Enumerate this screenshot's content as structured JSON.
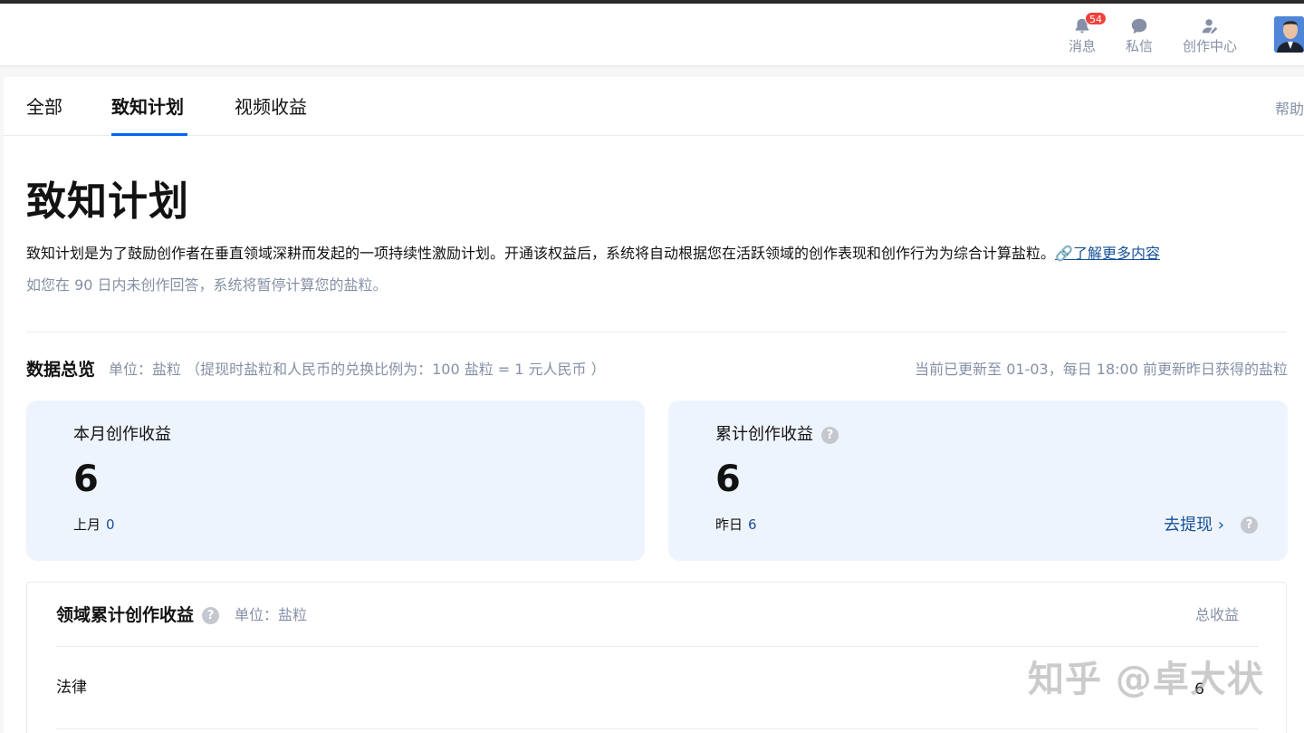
{
  "header": {
    "messages_label": "消息",
    "messages_badge": "54",
    "dm_label": "私信",
    "creator_label": "创作中心"
  },
  "tabs": [
    {
      "label": "全部"
    },
    {
      "label": "致知计划"
    },
    {
      "label": "视频收益"
    }
  ],
  "help_label": "帮助",
  "page": {
    "title": "致知计划",
    "description": "致知计划是为了鼓励创作者在垂直领域深耕而发起的一项持续性激励计划。开通该权益后，系统将自动根据您在活跃领域的创作表现和创作行为为综合计算盐粒。",
    "learn_more": "🔗了解更多内容",
    "note": "如您在 90 日内未创作回答，系统将暂停计算您的盐粒。"
  },
  "overview": {
    "title": "数据总览",
    "unit": "单位：盐粒  （提现时盐粒和人民币的兑换比例为：100 盐粒 = 1 元人民币 ）",
    "update_note": "当前已更新至 01-03，每日 18:00 前更新昨日获得的盐粒"
  },
  "cards": {
    "month": {
      "title": "本月创作收益",
      "value": "6",
      "sub_label": "上月",
      "sub_value": "0"
    },
    "total": {
      "title": "累计创作收益",
      "value": "6",
      "sub_label": "昨日",
      "sub_value": "6",
      "withdraw": "去提现 ›"
    }
  },
  "domain_table": {
    "title": "领域累计创作收益",
    "unit": "单位：盐粒",
    "column": "总收益",
    "rows": [
      {
        "name": "法律",
        "value": "6"
      }
    ]
  },
  "watermark": "知乎 @卓大状",
  "colors": {
    "accent": "#0066ff",
    "link": "#175199",
    "card_bg": "#eef4fd",
    "badge": "#f1403c"
  }
}
